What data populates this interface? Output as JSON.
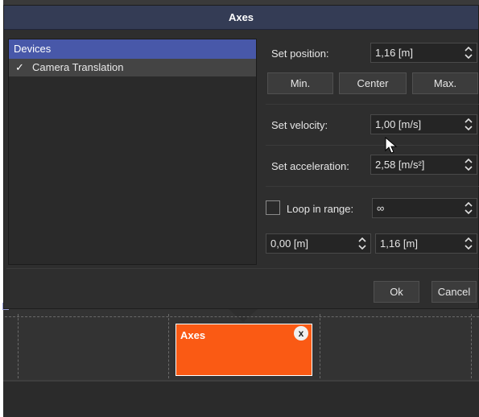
{
  "dialog": {
    "title": "Axes"
  },
  "devices": {
    "header": "Devices",
    "items": [
      {
        "label": "Camera Translation",
        "checked": true,
        "check_glyph": "✓"
      }
    ]
  },
  "form": {
    "position": {
      "label": "Set position:",
      "value": "1,16 [m]"
    },
    "position_buttons": {
      "min": "Min.",
      "center": "Center",
      "max": "Max."
    },
    "velocity": {
      "label": "Set velocity:",
      "value": "1,00 [m/s]"
    },
    "acceleration": {
      "label": "Set acceleration:",
      "value": "2,58 [m/s²]"
    },
    "loop": {
      "label": "Loop in range:",
      "checked": false,
      "value": "∞"
    },
    "range": {
      "start": "0,00 [m]",
      "end": "1,16 [m]"
    }
  },
  "buttons": {
    "ok": "Ok",
    "cancel": "Cancel"
  },
  "timeline": {
    "clip": {
      "label": "Axes",
      "close_glyph": "x",
      "color": "#fa5a14"
    }
  },
  "icons": {
    "spin_arrows": "spin-updown-icon",
    "dropdown": "dropdown-icon",
    "cursor": "mouse-pointer-icon",
    "clip_close": "close-icon"
  },
  "colors": {
    "title_bar": "#343c55",
    "devices_header": "#4858a9",
    "dialog_bg": "#2e2e2e",
    "accent_clip": "#fa5a14"
  }
}
